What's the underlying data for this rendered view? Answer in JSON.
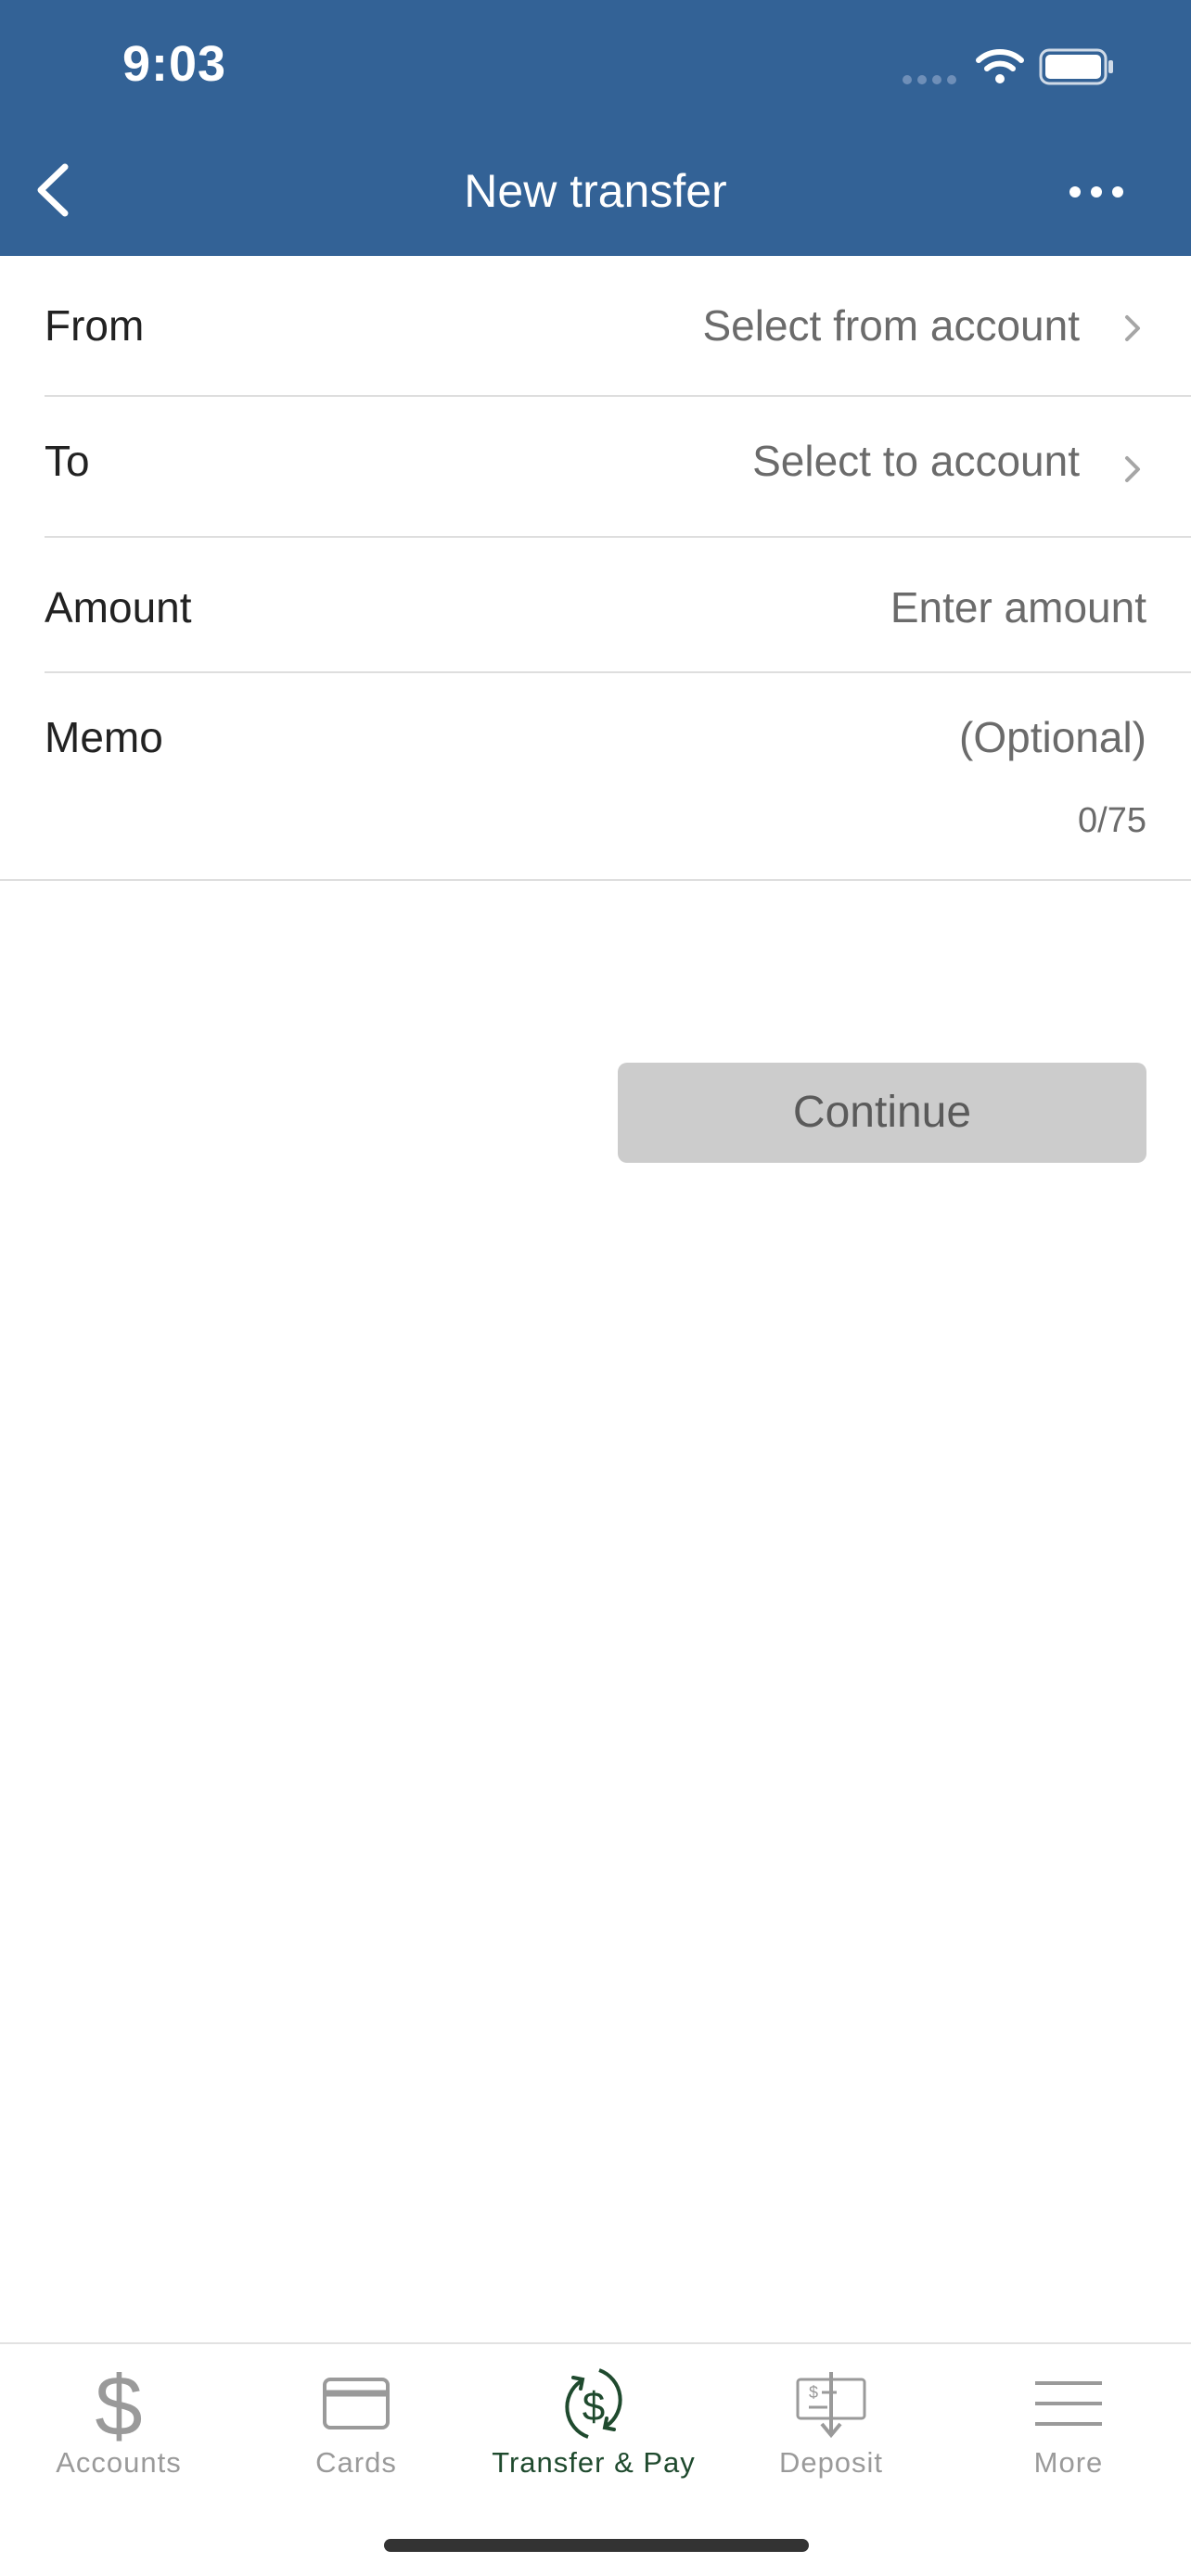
{
  "status_bar": {
    "time": "9:03",
    "signal_icon": "cellular-signal-icon",
    "wifi_icon": "wifi-icon",
    "battery_icon": "battery-icon"
  },
  "header": {
    "title": "New transfer",
    "back_icon": "chevron-left-icon",
    "more_icon": "ellipsis-icon",
    "background_color": "#336296"
  },
  "form": {
    "from": {
      "label": "From",
      "value": "Select from account"
    },
    "to": {
      "label": "To",
      "value": "Select to account"
    },
    "amount": {
      "label": "Amount",
      "placeholder": "Enter amount"
    },
    "memo": {
      "label": "Memo",
      "placeholder": "(Optional)",
      "counter": "0/75"
    }
  },
  "continue_button": {
    "label": "Continue",
    "state": "disabled"
  },
  "tabbar": {
    "active_color": "#1f4a2e",
    "inactive_color": "#9a9a9a",
    "items": [
      {
        "label": "Accounts",
        "icon": "dollar-icon"
      },
      {
        "label": "Cards",
        "icon": "card-icon"
      },
      {
        "label": "Transfer & Pay",
        "icon": "transfer-dollar-icon",
        "active": true
      },
      {
        "label": "Deposit",
        "icon": "check-deposit-icon"
      },
      {
        "label": "More",
        "icon": "menu-icon"
      }
    ]
  }
}
